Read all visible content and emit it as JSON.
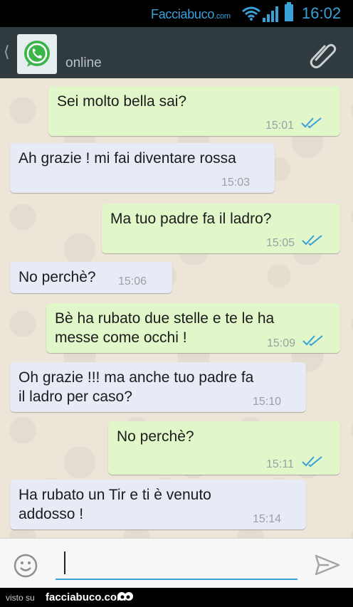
{
  "status_bar": {
    "brand": "Facciabuco",
    "brand_suffix": ".com",
    "time": "16:02"
  },
  "header": {
    "status": "online"
  },
  "messages": [
    {
      "dir": "out",
      "text": "Sei molto bella sai?",
      "time": "15:01",
      "read": true
    },
    {
      "dir": "in",
      "text": "Ah grazie ! mi fai diventare rossa",
      "time": "15:03"
    },
    {
      "dir": "out",
      "text": "Ma tuo padre fa il ladro?",
      "time": "15:05",
      "read": true
    },
    {
      "dir": "in",
      "text": "No perchè?",
      "time": "15:06"
    },
    {
      "dir": "out",
      "text": "Bè ha rubato due stelle e te le ha\nmesse come occhi !",
      "time": "15:09",
      "read": true
    },
    {
      "dir": "in",
      "text": "Oh  grazie !!! ma anche tuo padre fa\nil ladro per caso?",
      "time": "15:10"
    },
    {
      "dir": "out",
      "text": "No perchè?",
      "time": "15:11",
      "read": true
    },
    {
      "dir": "in",
      "text": "Ha rubato un Tir e ti è venuto\naddosso !",
      "time": "15:14"
    }
  ],
  "input": {
    "value": ""
  },
  "footer": {
    "label": "visto su",
    "site": "facciabuco.com"
  },
  "colors": {
    "accent": "#3aa0d8",
    "outgoing": "#e1f7c9",
    "incoming": "#e7ebf6",
    "header": "#2f3b3f",
    "read_ticks": "#3aa0d8"
  }
}
